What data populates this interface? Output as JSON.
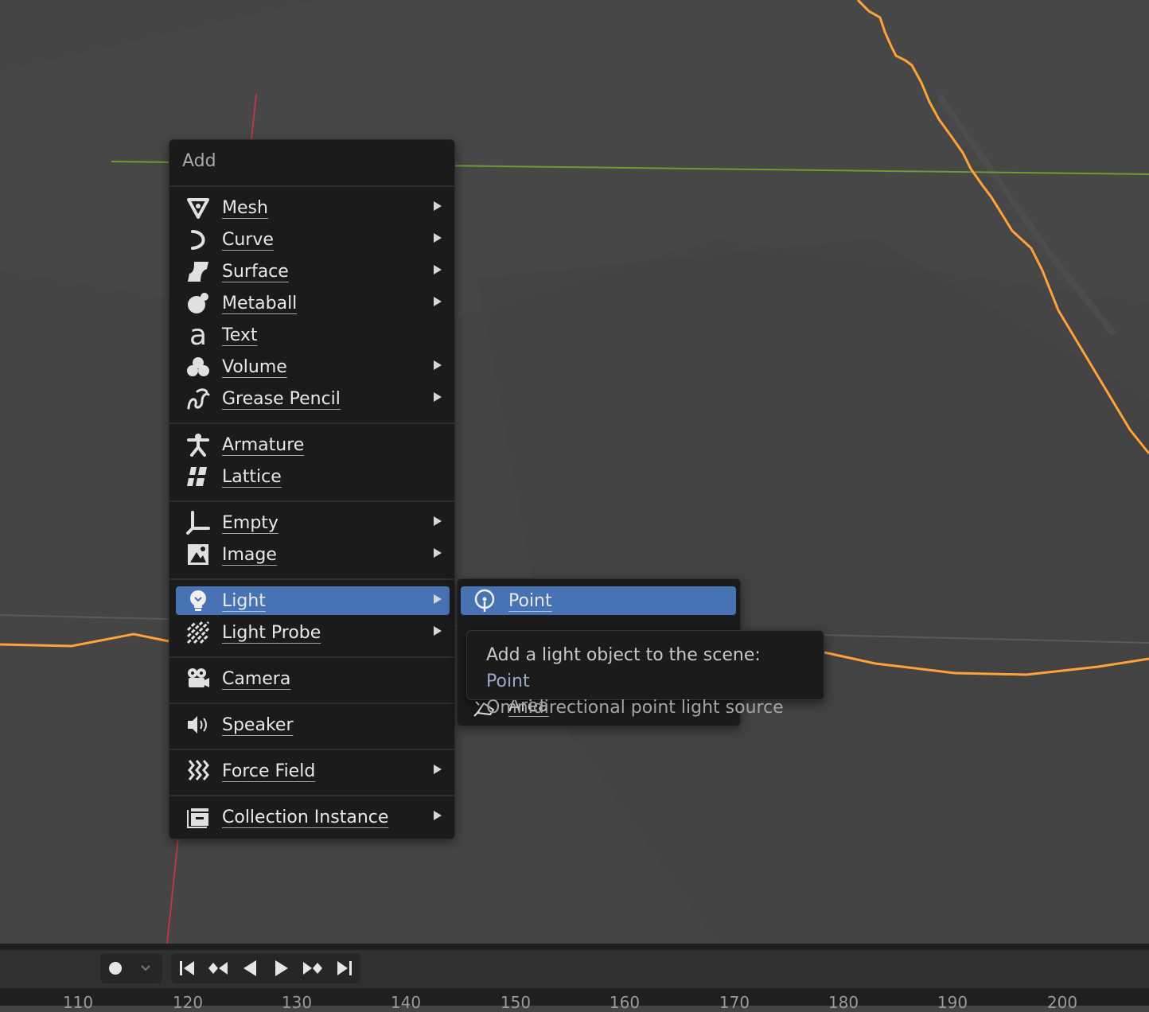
{
  "menu": {
    "title": "Add",
    "items": [
      {
        "label": "Mesh",
        "icon": "mesh-icon",
        "submenu": true
      },
      {
        "label": "Curve",
        "icon": "curve-icon",
        "submenu": true
      },
      {
        "label": "Surface",
        "icon": "surface-icon",
        "submenu": true
      },
      {
        "label": "Metaball",
        "icon": "metaball-icon",
        "submenu": true
      },
      {
        "label": "Text",
        "icon": "text-icon",
        "submenu": false
      },
      {
        "label": "Volume",
        "icon": "volume-icon",
        "submenu": true
      },
      {
        "label": "Grease Pencil",
        "icon": "grease-pencil-icon",
        "submenu": true
      },
      {
        "label": "Armature",
        "icon": "armature-icon",
        "submenu": false
      },
      {
        "label": "Lattice",
        "icon": "lattice-icon",
        "submenu": false
      },
      {
        "label": "Empty",
        "icon": "empty-icon",
        "submenu": true
      },
      {
        "label": "Image",
        "icon": "image-icon",
        "submenu": true
      },
      {
        "label": "Light",
        "icon": "light-bulb-icon",
        "submenu": true,
        "active": true
      },
      {
        "label": "Light Probe",
        "icon": "light-probe-icon",
        "submenu": true
      },
      {
        "label": "Camera",
        "icon": "camera-icon",
        "submenu": false
      },
      {
        "label": "Speaker",
        "icon": "speaker-icon",
        "submenu": false
      },
      {
        "label": "Force Field",
        "icon": "force-field-icon",
        "submenu": true
      },
      {
        "label": "Collection Instance",
        "icon": "collection-icon",
        "submenu": true
      }
    ]
  },
  "light_submenu": {
    "items": [
      {
        "label": "Point",
        "icon": "point-light-icon",
        "active": true
      },
      {
        "label": "Area",
        "icon": "area-light-icon"
      }
    ]
  },
  "tooltip": {
    "prefix": "Add a light object to the scene:",
    "value": "Point",
    "description": "Omnidirectional point light source"
  },
  "timeline": {
    "ticks": [
      "110",
      "120",
      "130",
      "140",
      "150",
      "160",
      "170",
      "180",
      "190",
      "200"
    ]
  },
  "colors": {
    "accent": "#4772b3",
    "selection_outline": "#ffa23a",
    "x_axis": "#b5394a",
    "y_axis": "#6f9a32"
  }
}
